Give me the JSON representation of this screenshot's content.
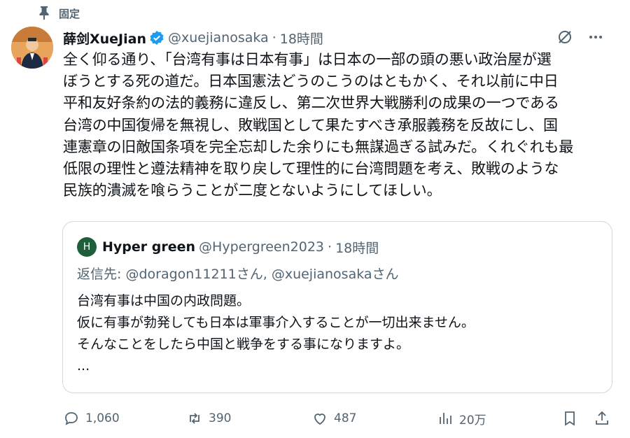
{
  "pinned_label": "固定",
  "tweet": {
    "display_name": "薛剑XueJian",
    "handle": "@xuejianosaka",
    "separator": "·",
    "time": "18時間",
    "text": "全く仰る通り、「台湾有事は日本有事」は日本の一部の頭の悪い政治屋が選\nぼうとする死の道だ。日本国憲法どうのこうのはともかく、それ以前に中日\n平和友好条約の法的義務に違反し、第二次世界大戦勝利の成果の一つである\n台湾の中国復帰を無視し、敗戦国として果たすべき承服義務を反故にし、国\n連憲章の旧敵国条項を完全忘却した余りにも無謀過ぎる試みだ。くれぐれも最\n低限の理性と遵法精神を取り戻して理性的に台湾問題を考え、敗戦のような\n民族的潰滅を喰らうことが二度とないようにしてほしい。"
  },
  "quote": {
    "avatar_letter": "H",
    "display_name": "Hyper green",
    "handle": "@Hypergreen2023",
    "separator": "·",
    "time": "18時間",
    "reply_to": "返信先: @doragon11211さん, @xuejianosakaさん",
    "text": "台湾有事は中国の内政問題。\n仮に有事が勃発しても日本は軍事介入することが一切出来ません。\nそんなことをしたら中国と戦争をする事になりますよ。\n..."
  },
  "actions": {
    "replies": "1,060",
    "reposts": "390",
    "likes": "487",
    "views": "20万"
  },
  "colors": {
    "text": "#0f1419",
    "secondary": "#536471",
    "verified": "#1d9bf0",
    "border": "#cfd9de"
  }
}
